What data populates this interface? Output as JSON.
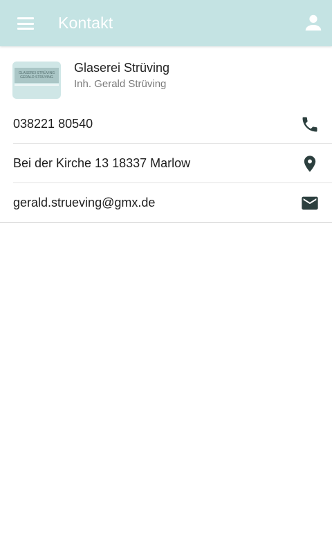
{
  "appbar": {
    "title": "Kontakt",
    "menu_icon": "menu-icon",
    "account_icon": "account-icon",
    "background": "#c4e3e3"
  },
  "company": {
    "name": "Glaserei Strüving",
    "owner": "Inh. Gerald Strüving",
    "logo": {
      "line1": "GLASEREI STRÜVING",
      "line2": "GERALD STRÜVING"
    }
  },
  "contacts": [
    {
      "type": "phone",
      "value": "038221 80540",
      "icon": "phone-icon"
    },
    {
      "type": "address",
      "value": "Bei der Kirche 13 18337 Marlow",
      "icon": "location-pin-icon"
    },
    {
      "type": "email",
      "value": "gerald.strueving@gmx.de",
      "icon": "mail-icon"
    }
  ],
  "colors": {
    "icon": "#2c3f3e",
    "divider": "#e4e4e4"
  }
}
